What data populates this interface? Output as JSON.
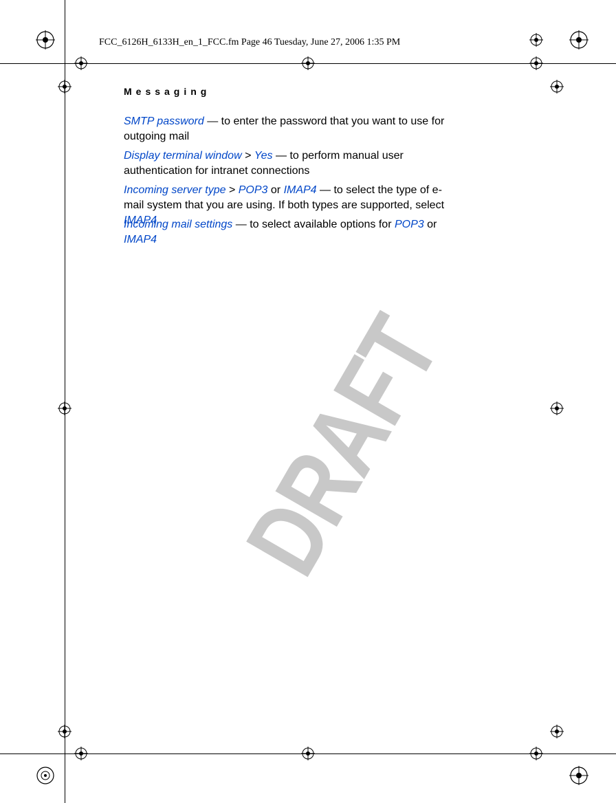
{
  "header": "FCC_6126H_6133H_en_1_FCC.fm  Page 46  Tuesday, June 27, 2006  1:35 PM",
  "section": "Messaging",
  "watermark": "DRAFT",
  "page_number": "46",
  "paras": {
    "p1": {
      "lead": "SMTP password",
      "rest": " — to enter the password that you want to use for outgoing mail"
    },
    "p2": {
      "lead": "Display terminal window",
      "sep": " > ",
      "opt": "Yes",
      "rest": " — to perform manual user authentication for intranet connections"
    },
    "p3": {
      "lead": "Incoming server type",
      "sep1": " > ",
      "opt1": "POP3",
      "or1": " or ",
      "opt2": "IMAP4",
      "rest": " — to select the type of e-mail system that you are using. If both types are supported, select ",
      "tail": "IMAP4"
    },
    "p4": {
      "lead": "Incoming mail settings",
      "rest": " — to select available options for ",
      "opt1": "POP3",
      "or1": " or ",
      "opt2": "IMAP4"
    }
  }
}
